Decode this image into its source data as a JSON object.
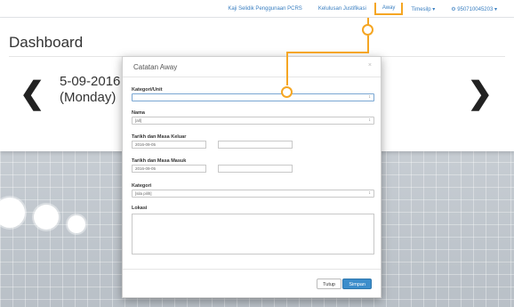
{
  "navbar": {
    "items": [
      {
        "label": "Kaji Selidik Penggunaan PCRS"
      },
      {
        "label": "Kelulusan Justifikasi"
      },
      {
        "label": "Away"
      },
      {
        "label": "Timesilp ▾"
      },
      {
        "label": "⚙ 950710045203 ▾"
      }
    ]
  },
  "dashboard": {
    "title": "Dashboard",
    "date": "5-09-2016",
    "day": "(Monday)"
  },
  "modal": {
    "title": "Catatan Away",
    "close": "×",
    "fields": {
      "kategori_unit_label": "Kategori/Unit",
      "nama_label": "Nama",
      "nama_value": "[all]",
      "keluar_label": "Tarikh dan Masa Keluar",
      "keluar_date": "2016-09-05",
      "masuk_label": "Tarikh dan Masa Masuk",
      "masuk_date": "2016-09-05",
      "kategori_label": "Kategori",
      "kategori_value": "[sila pilih]",
      "lokasi_label": "Lokasi"
    },
    "buttons": {
      "close_label": "Tutup",
      "save_label": "Simpan"
    }
  },
  "colors": {
    "accent": "#f5a623",
    "link": "#3a7fc1",
    "primary_button": "#3c8dcb"
  }
}
